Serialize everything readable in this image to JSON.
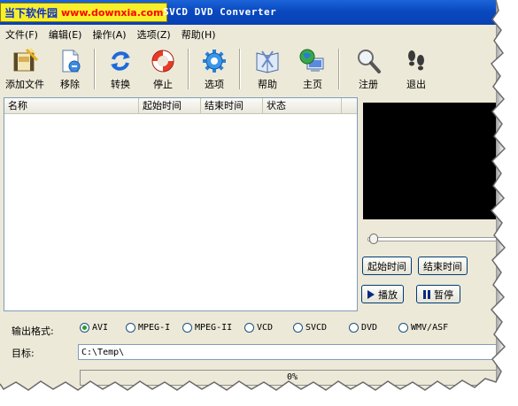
{
  "title": {
    "logo_cn": "当下软件园",
    "logo_url": "www.downxia.com",
    "app_title": "SVCD DVD Converter"
  },
  "menu": [
    {
      "label": "文件(F)"
    },
    {
      "label": "编辑(E)"
    },
    {
      "label": "操作(A)"
    },
    {
      "label": "选项(Z)"
    },
    {
      "label": "帮助(H)"
    }
  ],
  "toolbar": {
    "add": "添加文件",
    "remove": "移除",
    "convert": "转换",
    "stop": "停止",
    "options": "选项",
    "help": "帮助",
    "home": "主页",
    "register": "注册",
    "exit": "退出"
  },
  "list": {
    "columns": [
      {
        "label": "名称"
      },
      {
        "label": "起始时间"
      },
      {
        "label": "结束时间"
      },
      {
        "label": "状态"
      }
    ],
    "rows": []
  },
  "player": {
    "start_time_btn": "起始时间",
    "end_time_btn": "结束时间",
    "play_btn": "播放",
    "pause_btn": "暂停",
    "seek_position": 0
  },
  "output": {
    "format_label": "输出格式:",
    "formats": [
      {
        "label": "AVI",
        "selected": true
      },
      {
        "label": "MPEG-I",
        "selected": false
      },
      {
        "label": "MPEG-II",
        "selected": false
      },
      {
        "label": "VCD",
        "selected": false
      },
      {
        "label": "SVCD",
        "selected": false
      },
      {
        "label": "DVD",
        "selected": false
      },
      {
        "label": "WMV/ASF",
        "selected": false
      }
    ],
    "target_label": "目标:",
    "target_value": "C:\\Temp\\",
    "progress_text": "0%",
    "progress_value": 0
  },
  "colors": {
    "title_bar": "#0a49c0",
    "window_bg": "#ece9d8",
    "logo_bg": "#f7ef2a",
    "logo_url": "#ff0000",
    "radio_dot": "#2c9c2c"
  }
}
